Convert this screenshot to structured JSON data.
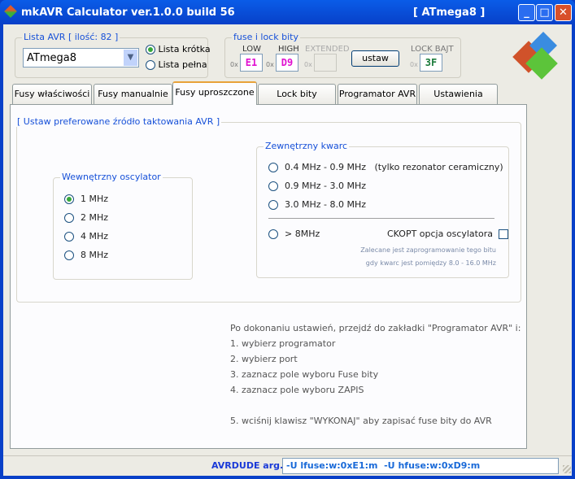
{
  "window": {
    "title": "mkAVR Calculator ver.1.0.0 build 56",
    "device_tag": "[ ATmega8 ]"
  },
  "avr_list": {
    "label": "Lista AVR [ ilość: 82 ]",
    "selected": "ATmega8",
    "short_list": "Lista krótka",
    "full_list": "Lista pełna"
  },
  "fuses": {
    "label": "fuse i lock bity",
    "prefix": "0x",
    "low_label": "LOW",
    "low": "E1",
    "high_label": "HIGH",
    "high": "D9",
    "ext_label": "EXTENDED",
    "ext": "",
    "set_button": "ustaw",
    "lock_label": "LOCK BAJT",
    "lock": "3F",
    "colors": {
      "fuse": "#e010d0",
      "lock": "#1a7a3a"
    }
  },
  "tabs": [
    "Fusy właściwości",
    "Fusy manualnie",
    "Fusy uproszczone",
    "Lock bity",
    "Programator AVR",
    "Ustawienia"
  ],
  "main": {
    "source_label": "[ Ustaw preferowane źródło taktowania AVR ]",
    "internal": {
      "label": "Wewnętrzny oscylator",
      "options": [
        "1 MHz",
        "2 MHz",
        "4 MHz",
        "8 MHz"
      ]
    },
    "external": {
      "label": "Zewnętrzny kwarc",
      "options": [
        "0.4 MHz - 0.9 MHz",
        "0.9 MHz - 3.0 MHz",
        "3.0 MHz - 8.0 MHz",
        "> 8MHz"
      ],
      "ceramic_note": "(tylko rezonator ceramiczny)",
      "ckopt": "CKOPT opcja oscylatora",
      "hint1": "Zalecane jest zaprogramowanie tego bitu",
      "hint2": "gdy kwarc jest pomiędzy 8.0 - 16.0 MHz"
    },
    "instructions": [
      "Po dokonaniu ustawień, przejdź do zakładki \"Programator AVR\" i:",
      "1. wybierz programator",
      "2. wybierz port",
      "3. zaznacz pole wyboru Fuse bity",
      "4. zaznacz pole wyboru ZAPIS",
      "5. wciśnij klawisz \"WYKONAJ\" aby zapisać fuse bity do AVR"
    ]
  },
  "status": {
    "label": "AVRDUDE arg.",
    "args": "-U lfuse:w:0xE1:m  -U hfuse:w:0xD9:m"
  }
}
